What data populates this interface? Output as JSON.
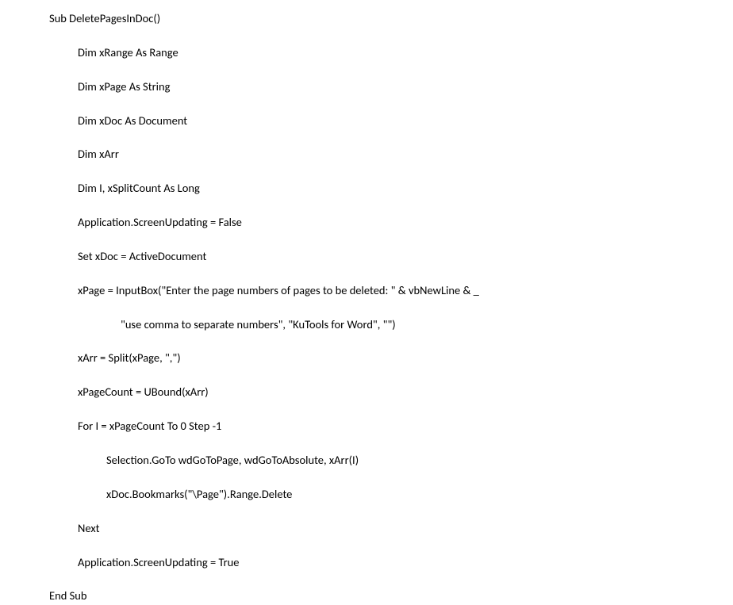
{
  "code": {
    "line1": "Sub DeletePagesInDoc()",
    "line2": "Dim xRange As Range",
    "line3": "Dim xPage As String",
    "line4": "Dim xDoc As Document",
    "line5": "Dim xArr",
    "line6": "Dim I, xSplitCount As Long",
    "line7": "Application.ScreenUpdating = False",
    "line8": "Set xDoc = ActiveDocument",
    "line9": "xPage = InputBox(\"Enter the page numbers of pages to be deleted: \" & vbNewLine & _",
    "line10": "\"use comma to separate numbers\", \"KuTools for Word\", \"\")",
    "line11": "xArr = Split(xPage, \",\")",
    "line12": "xPageCount = UBound(xArr)",
    "line13": "For I = xPageCount To 0 Step -1",
    "line14": "Selection.GoTo wdGoToPage, wdGoToAbsolute, xArr(I)",
    "line15": "xDoc.Bookmarks(\"\\Page\").Range.Delete",
    "line16": "Next",
    "line17": "Application.ScreenUpdating = True",
    "line18": "End Sub"
  }
}
